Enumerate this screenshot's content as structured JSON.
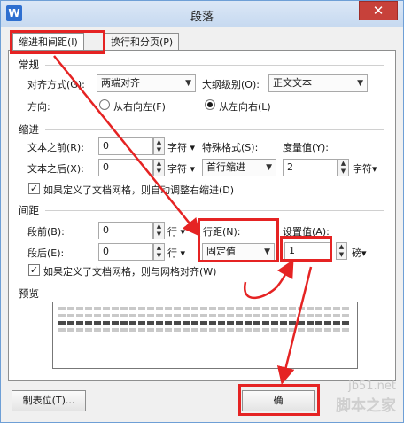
{
  "window": {
    "title": "段落",
    "app_icon": "W",
    "close_glyph": "✕"
  },
  "tabs": [
    {
      "label": "缩进和间距(I)"
    },
    {
      "label": "换行和分页(P)"
    }
  ],
  "general": {
    "heading": "常规",
    "align_label": "对齐方式(G):",
    "align_value": "两端对齐",
    "outline_label": "大纲级别(O):",
    "outline_value": "正文文本",
    "direction_label": "方向:",
    "rtl_label": "从右向左(F)",
    "ltr_label": "从左向右(L)"
  },
  "indent": {
    "heading": "缩进",
    "before_label": "文本之前(R):",
    "before_value": "0",
    "before_unit": "字符",
    "after_label": "文本之后(X):",
    "after_value": "0",
    "after_unit": "字符",
    "special_label": "特殊格式(S):",
    "special_value": "首行缩进",
    "measure_label": "度量值(Y):",
    "measure_value": "2",
    "measure_unit": "字符",
    "grid_checkbox": "如果定义了文档网格，则自动调整右缩进(D)"
  },
  "spacing": {
    "heading": "间距",
    "before_label": "段前(B):",
    "before_value": "0",
    "before_unit": "行",
    "after_label": "段后(E):",
    "after_value": "0",
    "after_unit": "行",
    "line_label": "行距(N):",
    "line_value": "固定值",
    "setvalue_label": "设置值(A):",
    "setvalue_value": "1",
    "setvalue_unit": "磅",
    "grid_checkbox": "如果定义了文档网格，则与网格对齐(W)"
  },
  "preview": {
    "heading": "预览"
  },
  "buttons": {
    "tabs_button": "制表位(T)...",
    "ok_button": "确"
  },
  "watermark": {
    "url": "jb51.net",
    "name": "脚本之家"
  },
  "colors": {
    "annotation_red": "#e52323"
  }
}
